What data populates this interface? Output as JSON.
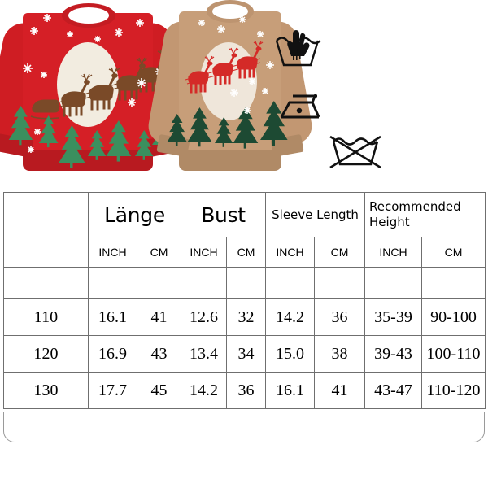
{
  "product_photo": {
    "alt": "Kids Christmas reindeer sweaters",
    "sweaters": [
      {
        "name": "red-christmas-sweater",
        "body_color": "#d51f26",
        "trim_color": "#b81a20",
        "moon_color": "#f2ece0",
        "tree_color": "#3b8f5e",
        "deer_color": "#7a4a28",
        "snowflake_color": "#ffffff"
      },
      {
        "name": "tan-christmas-sweater",
        "body_color": "#c79e79",
        "trim_color": "#b08a66",
        "moon_color": "#efe6da",
        "tree_color": "#1d4a33",
        "deer_color": "#d42a27",
        "snowflake_color": "#ffffff"
      }
    ]
  },
  "care_symbols": [
    {
      "name": "hand-wash-icon",
      "label": "Hand wash"
    },
    {
      "name": "iron-low-heat-icon",
      "label": "Iron low heat"
    },
    {
      "name": "do-not-machine-wash-icon",
      "label": "Do not machine wash"
    }
  ],
  "size_table": {
    "group_headers": {
      "size": "",
      "length": "Länge",
      "bust": "Bust",
      "sleeve": "Sleeve Length",
      "height": "Recommended Height"
    },
    "unit_headers": {
      "size": "",
      "length_inch": "INCH",
      "length_cm": "CM",
      "bust_inch": "INCH",
      "bust_cm": "CM",
      "sleeve_inch": "INCH",
      "sleeve_cm": "CM",
      "height_inch": "INCH",
      "height_cm": "CM"
    },
    "rows": [
      {
        "size": "110",
        "length_inch": "16.1",
        "length_cm": "41",
        "bust_inch": "12.6",
        "bust_cm": "32",
        "sleeve_inch": "14.2",
        "sleeve_cm": "36",
        "height_inch": "35-39",
        "height_cm": "90-100"
      },
      {
        "size": "120",
        "length_inch": "16.9",
        "length_cm": "43",
        "bust_inch": "13.4",
        "bust_cm": "34",
        "sleeve_inch": "15.0",
        "sleeve_cm": "38",
        "height_inch": "39-43",
        "height_cm": "100-110"
      },
      {
        "size": "130",
        "length_inch": "17.7",
        "length_cm": "45",
        "bust_inch": "14.2",
        "bust_cm": "36",
        "sleeve_inch": "16.1",
        "sleeve_cm": "41",
        "height_inch": "43-47",
        "height_cm": "110-120"
      }
    ]
  },
  "colors": {
    "table_border": "#6f6f6f",
    "background": "#ffffff",
    "text": "#000000"
  }
}
